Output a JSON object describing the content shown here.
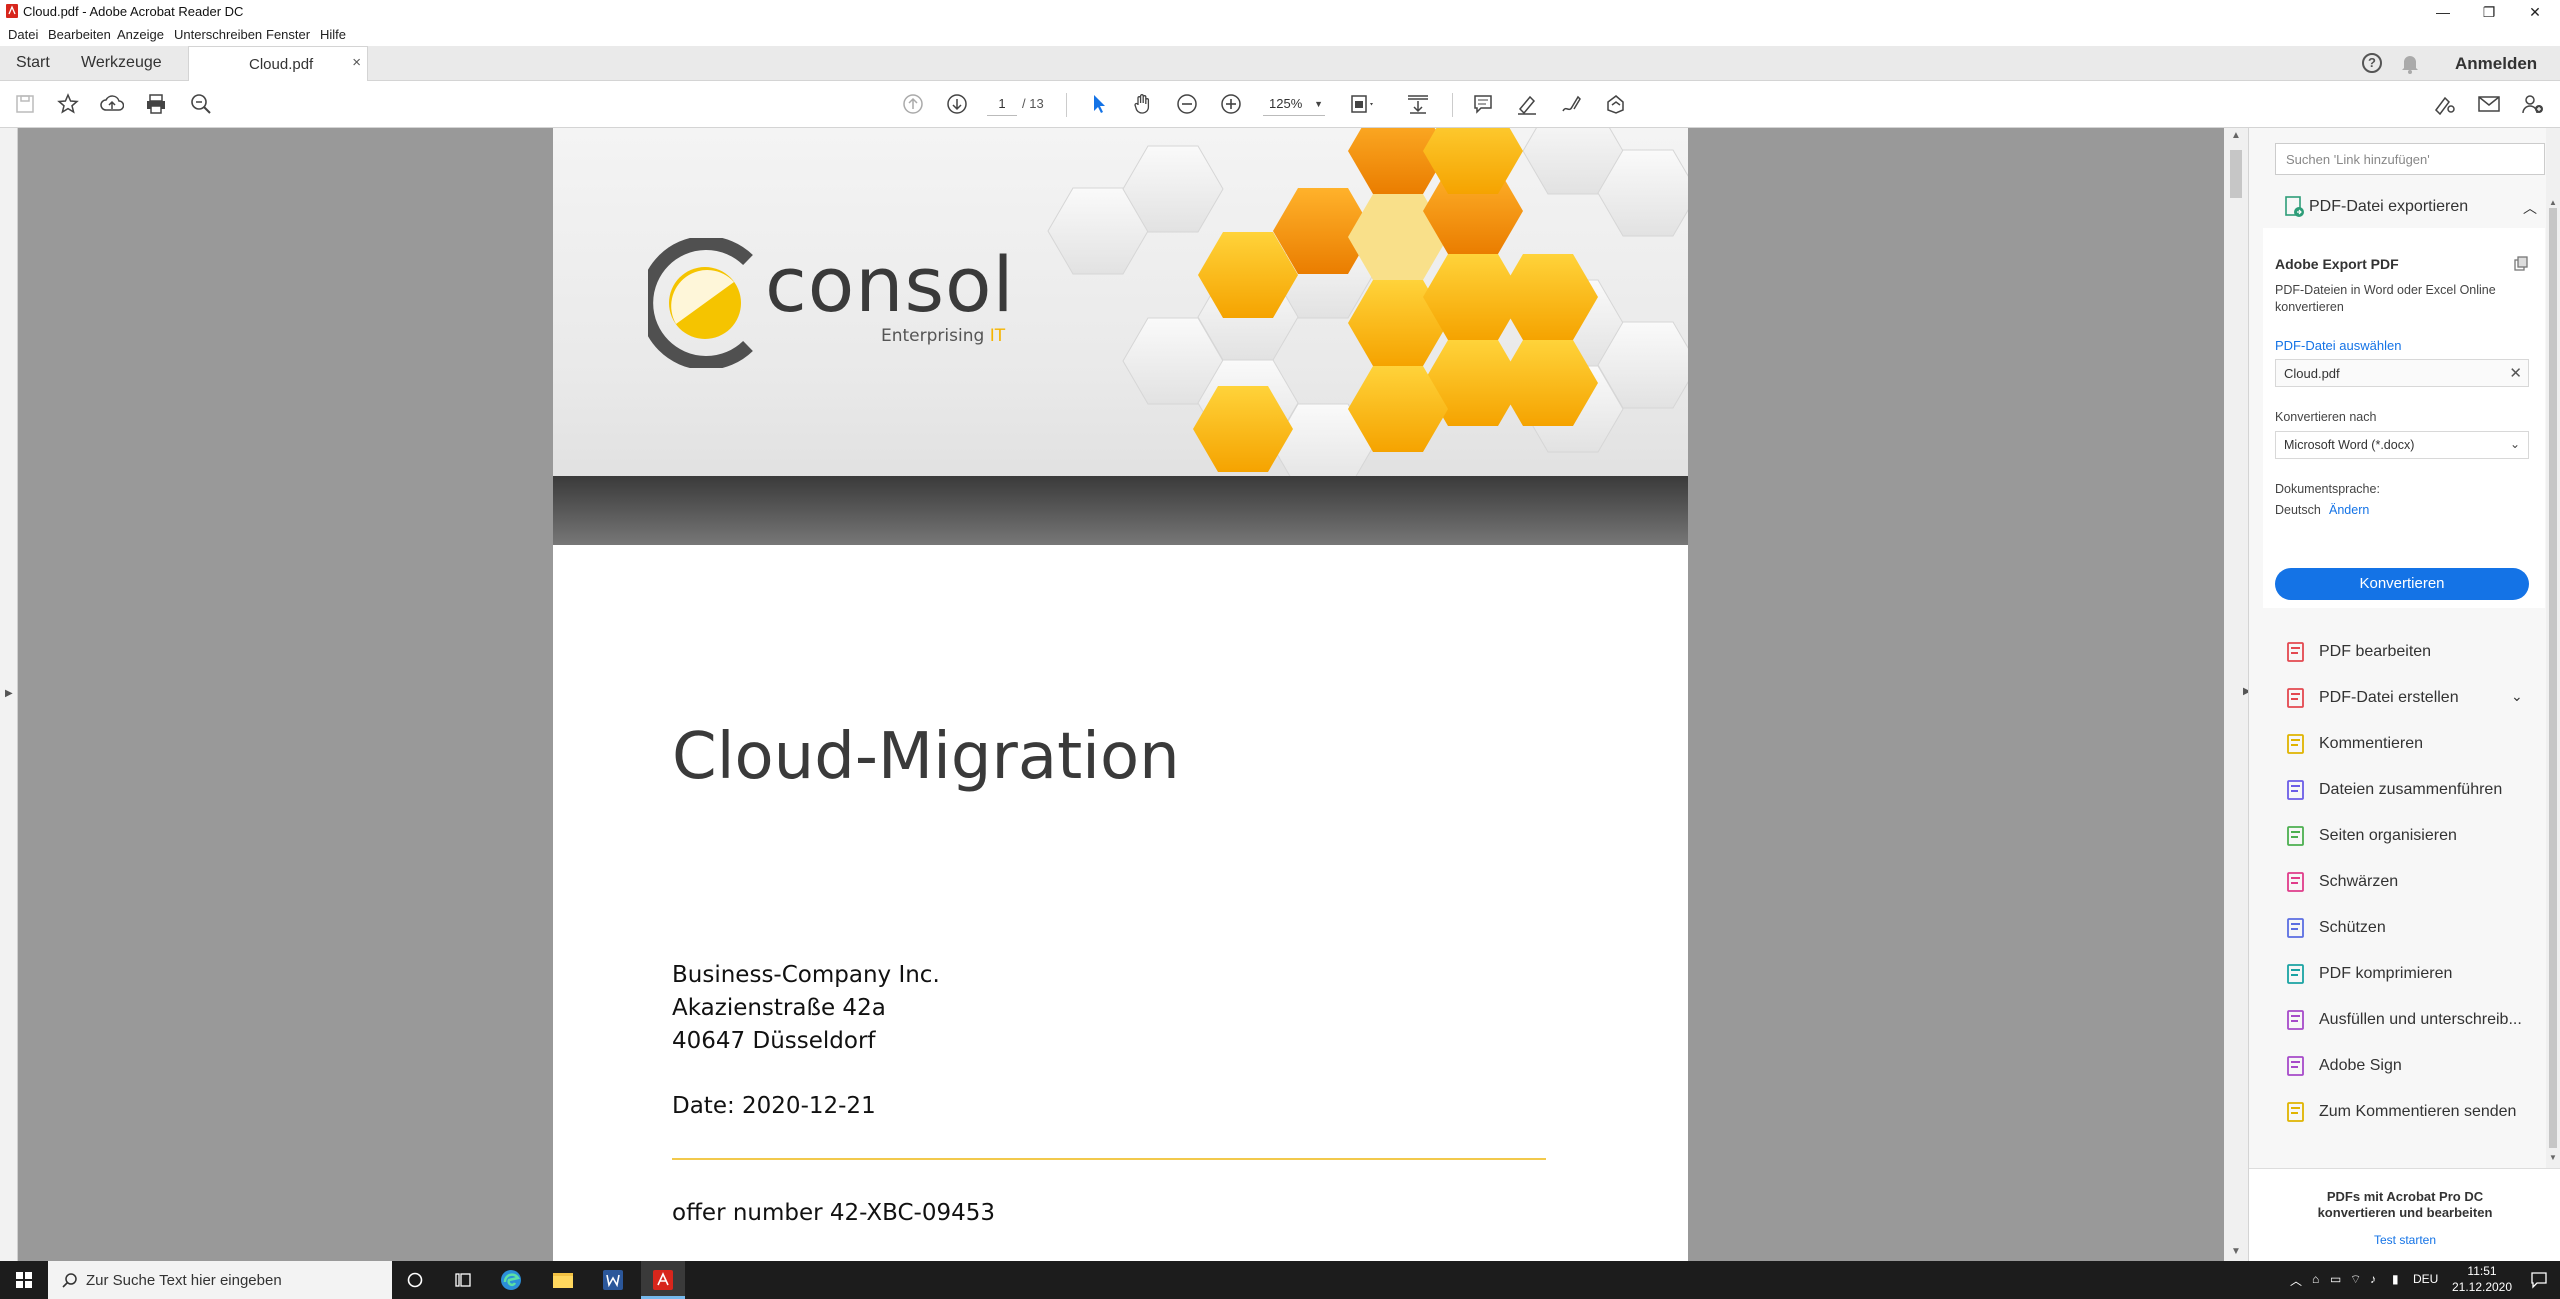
{
  "window": {
    "title": "Cloud.pdf - Adobe Acrobat Reader DC",
    "minimize": "—",
    "maximize": "❐",
    "close": "✕"
  },
  "menu": [
    "Datei",
    "Bearbeiten",
    "Anzeige",
    "Unterschreiben",
    "Fenster",
    "Hilfe"
  ],
  "tabs": {
    "start": "Start",
    "tools": "Werkzeuge",
    "document": "Cloud.pdf",
    "close": "×",
    "help": "?",
    "sign_in": "Anmelden"
  },
  "toolbar": {
    "page_current": "1",
    "page_total": "/ 13",
    "zoom": "125%"
  },
  "document": {
    "logo_brand": "consol",
    "logo_tagline": "Enterprising",
    "logo_tagline_accent": "IT",
    "title": "Cloud-Migration",
    "address": [
      "Business-Company Inc.",
      "Akazienstraße 42a",
      "40647 Düsseldorf"
    ],
    "date": "Date: 2020-12-21",
    "offer": "offer number 42-XBC-09453"
  },
  "right_pane": {
    "search_placeholder": "Suchen 'Link hinzufügen'",
    "export_header": "PDF-Datei exportieren",
    "card_title": "Adobe Export PDF",
    "card_desc": "PDF-Dateien in Word oder Excel Online konvertieren",
    "select_file": "PDF-Datei auswählen",
    "file_name": "Cloud.pdf",
    "convert_to_label": "Konvertieren nach",
    "convert_to_value": "Microsoft Word (*.docx)",
    "doc_language_label": "Dokumentsprache:",
    "doc_language": "Deutsch",
    "change": "Ändern",
    "convert_button": "Konvertieren",
    "tools": [
      {
        "label": "PDF bearbeiten",
        "icon": "edit-pdf-icon",
        "color": "#e34850"
      },
      {
        "label": "PDF-Datei erstellen",
        "icon": "create-pdf-icon",
        "color": "#e34850"
      },
      {
        "label": "Kommentieren",
        "icon": "comment-icon",
        "color": "#e0b400"
      },
      {
        "label": "Dateien zusammenführen",
        "icon": "combine-files-icon",
        "color": "#6b5ce7"
      },
      {
        "label": "Seiten organisieren",
        "icon": "organize-pages-icon",
        "color": "#4caf50"
      },
      {
        "label": "Schwärzen",
        "icon": "redact-icon",
        "color": "#e03c8a"
      },
      {
        "label": "Schützen",
        "icon": "protect-icon",
        "color": "#5b6ee1"
      },
      {
        "label": "PDF komprimieren",
        "icon": "compress-pdf-icon",
        "color": "#1aa3a3"
      },
      {
        "label": "Ausfüllen und unterschreib...",
        "icon": "fill-sign-icon",
        "color": "#a64ac9"
      },
      {
        "label": "Adobe Sign",
        "icon": "adobe-sign-icon",
        "color": "#a64ac9"
      },
      {
        "label": "Zum Kommentieren senden",
        "icon": "send-comment-icon",
        "color": "#e0b400"
      }
    ],
    "promo_text": "PDFs mit Acrobat Pro DC konvertieren und bearbeiten",
    "promo_link": "Test starten"
  },
  "taskbar": {
    "search_placeholder": "Zur Suche Text hier eingeben",
    "language": "DEU",
    "time": "11:51",
    "date": "21.12.2020"
  },
  "colors": {
    "accent_blue": "#1473e6",
    "honey": "#f5b400",
    "doc_bg": "#999999"
  }
}
